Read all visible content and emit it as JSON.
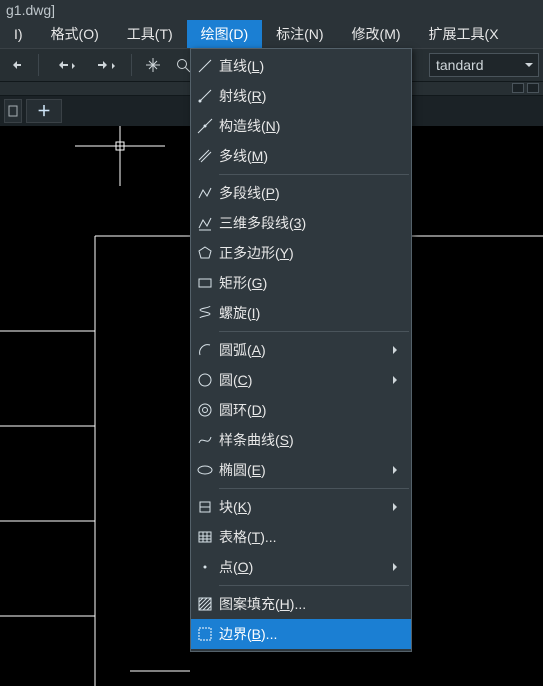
{
  "title_fragment": "g1.dwg]",
  "menubar": {
    "items": [
      {
        "label": "I)"
      },
      {
        "label": "格式(O)"
      },
      {
        "label": "工具(T)"
      },
      {
        "label": "绘图(D)"
      },
      {
        "label": "标注(N)"
      },
      {
        "label": "修改(M)"
      },
      {
        "label": "扩展工具(X"
      }
    ],
    "active_index": 3
  },
  "toolbar": {
    "combo_value": "tandard"
  },
  "dropdown": {
    "highlight_index": 18,
    "items": [
      {
        "icon": "line-icon",
        "label": "直线",
        "key": "L"
      },
      {
        "icon": "ray-icon",
        "label": "射线",
        "key": "R"
      },
      {
        "icon": "xline-icon",
        "label": "构造线",
        "key": "N"
      },
      {
        "icon": "mline-icon",
        "label": "多线",
        "key": "M"
      },
      {
        "sep": true
      },
      {
        "icon": "pline-icon",
        "label": "多段线",
        "key": "P"
      },
      {
        "icon": "3dpoly-icon",
        "label": "三维多段线",
        "key": "3"
      },
      {
        "icon": "polygon-icon",
        "label": "正多边形",
        "key": "Y"
      },
      {
        "icon": "rect-icon",
        "label": "矩形",
        "key": "G"
      },
      {
        "icon": "helix-icon",
        "label": "螺旋",
        "key": "I"
      },
      {
        "sep": true
      },
      {
        "icon": "arc-icon",
        "label": "圆弧",
        "key": "A",
        "submenu": true
      },
      {
        "icon": "circle-icon",
        "label": "圆",
        "key": "C",
        "submenu": true
      },
      {
        "icon": "donut-icon",
        "label": "圆环",
        "key": "D"
      },
      {
        "icon": "spline-icon",
        "label": "样条曲线",
        "key": "S"
      },
      {
        "icon": "ellipse-icon",
        "label": "椭圆",
        "key": "E",
        "submenu": true
      },
      {
        "sep": true
      },
      {
        "icon": "block-icon",
        "label": "块",
        "key": "K",
        "submenu": true
      },
      {
        "icon": "table-icon",
        "label": "表格",
        "key": "T",
        "ellipsis": true
      },
      {
        "icon": "point-icon",
        "label": "点",
        "key": "O",
        "submenu": true
      },
      {
        "sep": true
      },
      {
        "icon": "hatch-icon",
        "label": "图案填充",
        "key": "H",
        "ellipsis": true
      },
      {
        "icon": "boundary-icon",
        "label": "边界",
        "key": "B",
        "ellipsis": true
      }
    ]
  }
}
